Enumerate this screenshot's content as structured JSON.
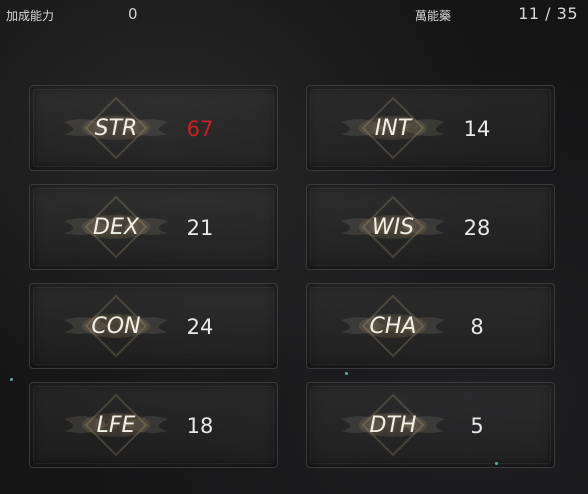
{
  "header": {
    "bonus_label": "加成能力",
    "bonus_value": "0",
    "points_label": "萬能藥",
    "points_value": "11 / 35"
  },
  "stats": [
    {
      "name": "STR",
      "value": "67",
      "highlight": true
    },
    {
      "name": "INT",
      "value": "14",
      "highlight": false
    },
    {
      "name": "DEX",
      "value": "21",
      "highlight": false
    },
    {
      "name": "WIS",
      "value": "28",
      "highlight": false
    },
    {
      "name": "CON",
      "value": "24",
      "highlight": false
    },
    {
      "name": "CHA",
      "value": "8",
      "highlight": false
    },
    {
      "name": "LFE",
      "value": "18",
      "highlight": false
    },
    {
      "name": "DTH",
      "value": "5",
      "highlight": false
    }
  ],
  "colors": {
    "highlight_value": "#c82020",
    "text": "#e8e8e8",
    "card_border": "#3a3a3a"
  }
}
